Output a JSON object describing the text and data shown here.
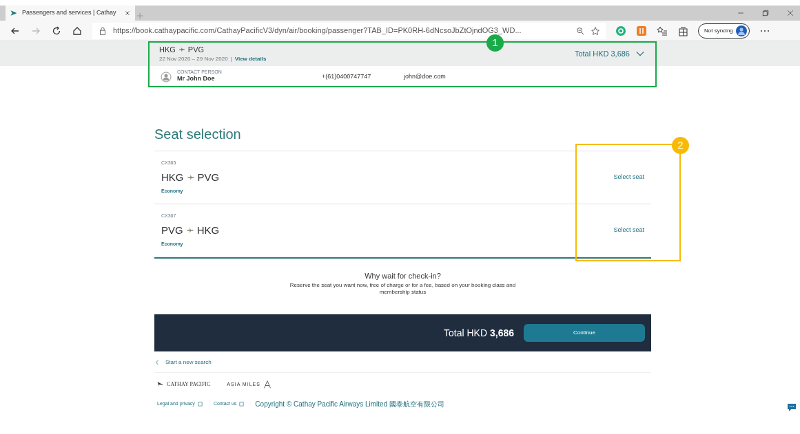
{
  "browser": {
    "tab": {
      "title": "Passengers and services | Cathay"
    },
    "url": "https://book.cathaypacific.com/CathayPacificV3/dyn/air/booking/passenger?TAB_ID=PK0RH-6dNcsoJbZtOjndOG3_WD...",
    "profile": {
      "label": "Not syncing"
    }
  },
  "summary": {
    "route_from": "HKG",
    "route_to": "PVG",
    "dates": "22 Nov 2020 – 29 Nov 2020",
    "separator": "|",
    "view_details": "View details",
    "total": "Total HKD 3,686",
    "contact_label": "CONTACT PERSON",
    "contact_name": "Mr John Doe",
    "phone": "+(61)0400747747",
    "email": "john@doe.com"
  },
  "seat_selection": {
    "title": "Seat selection",
    "flights": [
      {
        "flight": "CX365",
        "from": "HKG",
        "to": "PVG",
        "cabin": "Economy",
        "action": "Select seat"
      },
      {
        "flight": "CX367",
        "from": "PVG",
        "to": "HKG",
        "cabin": "Economy",
        "action": "Select seat"
      }
    ]
  },
  "promo": {
    "title": "Why wait for check-in?",
    "text": "Reserve the seat you want now, free of charge or for a fee, based on your booking class and membership status"
  },
  "footer_bar": {
    "total_label": "Total HKD",
    "total_amount": "3,686",
    "button": "Continue"
  },
  "new_search": "Start a new search",
  "logos": {
    "airline": "CATHAY PACIFIC",
    "miles": "ASIA MILES"
  },
  "footer_links": [
    "Legal and privacy",
    "Contact us"
  ],
  "copyright": "Copyright © Cathay Pacific Airways Limited 國泰航空有限公司",
  "annotations": [
    {
      "number": "1",
      "color": "#1aaa4a"
    },
    {
      "number": "2",
      "color": "#f7bb07"
    }
  ]
}
